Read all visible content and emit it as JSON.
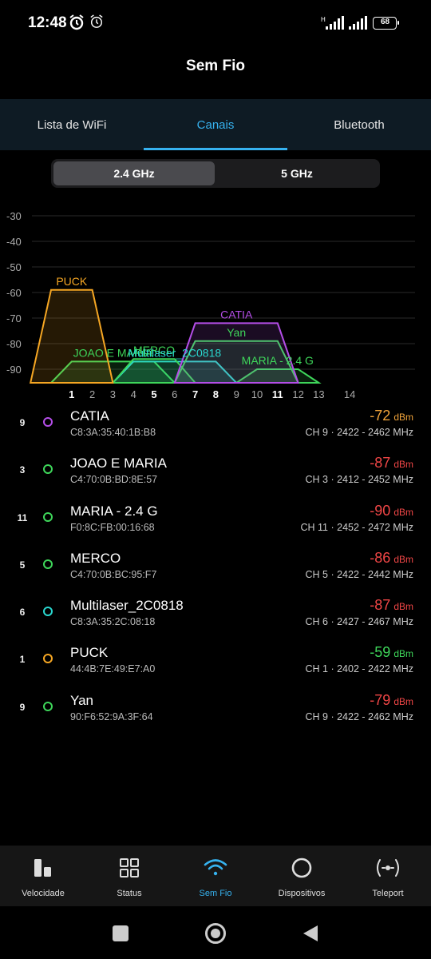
{
  "status": {
    "time": "12:48",
    "battery": "68"
  },
  "header": {
    "title": "Sem Fio"
  },
  "tabs": [
    {
      "label": "Lista de WiFi",
      "active": false
    },
    {
      "label": "Canais",
      "active": true
    },
    {
      "label": "Bluetooth",
      "active": false
    }
  ],
  "band_toggle": [
    {
      "label": "2.4 GHz",
      "active": true
    },
    {
      "label": "5 GHz",
      "active": false
    }
  ],
  "chart_data": {
    "type": "area",
    "y_ticks": [
      "-30",
      "-40",
      "-50",
      "-60",
      "-70",
      "-80",
      "-90"
    ],
    "ylim": [
      -95,
      -28
    ],
    "x_ticks": [
      {
        "label": "1",
        "ch": 1,
        "bold": true
      },
      {
        "label": "2",
        "ch": 2,
        "bold": false
      },
      {
        "label": "3",
        "ch": 3,
        "bold": false
      },
      {
        "label": "4",
        "ch": 4,
        "bold": false
      },
      {
        "label": "5",
        "ch": 5,
        "bold": true
      },
      {
        "label": "6",
        "ch": 6,
        "bold": false
      },
      {
        "label": "7",
        "ch": 7,
        "bold": true
      },
      {
        "label": "8",
        "ch": 8,
        "bold": true
      },
      {
        "label": "9",
        "ch": 9,
        "bold": false
      },
      {
        "label": "10",
        "ch": 10,
        "bold": false
      },
      {
        "label": "11",
        "ch": 11,
        "bold": true
      },
      {
        "label": "12",
        "ch": 12,
        "bold": false
      },
      {
        "label": "13",
        "ch": 13,
        "bold": false
      },
      {
        "label": "14",
        "ch": 14.5,
        "bold": false
      }
    ],
    "series": [
      {
        "name": "PUCK",
        "channel": 1,
        "signal": -59,
        "color": "#f5a623"
      },
      {
        "name": "CATIA",
        "channel": 9,
        "signal": -72,
        "color": "#b44ee8"
      },
      {
        "name": "Yan",
        "channel": 9,
        "signal": -79,
        "color": "#3ed65a"
      },
      {
        "name": "JOAO E MARIA",
        "channel": 3,
        "signal": -87,
        "color": "#3ed65a"
      },
      {
        "name": "MERCO",
        "channel": 5,
        "signal": -86,
        "color": "#3ed65a"
      },
      {
        "name": "Multilaser_2C0818",
        "channel": 6,
        "signal": -87,
        "color": "#2ad8d0"
      },
      {
        "name": "MARIA - 2.4 G",
        "channel": 11,
        "signal": -90,
        "color": "#3ed65a"
      }
    ]
  },
  "networks": [
    {
      "channel": "9",
      "ssid": "CATIA",
      "mac": "C8:3A:35:40:1B:B8",
      "signal": "-72",
      "unit": "dBm",
      "signal_color": "#f0a33a",
      "ring_color": "#b44ee8",
      "freq": "CH 9 · 2422 - 2462 MHz"
    },
    {
      "channel": "3",
      "ssid": "JOAO E MARIA",
      "mac": "C4:70:0B:BD:8E:57",
      "signal": "-87",
      "unit": "dBm",
      "signal_color": "#f04646",
      "ring_color": "#3ed65a",
      "freq": "CH 3 · 2412 - 2452 MHz"
    },
    {
      "channel": "11",
      "ssid": "MARIA - 2.4 G",
      "mac": "F0:8C:FB:00:16:68",
      "signal": "-90",
      "unit": "dBm",
      "signal_color": "#f04646",
      "ring_color": "#3ed65a",
      "freq": "CH 11 · 2452 - 2472 MHz"
    },
    {
      "channel": "5",
      "ssid": "MERCO",
      "mac": "C4:70:0B:BC:95:F7",
      "signal": "-86",
      "unit": "dBm",
      "signal_color": "#f04646",
      "ring_color": "#3ed65a",
      "freq": "CH 5 · 2422 - 2442 MHz"
    },
    {
      "channel": "6",
      "ssid": "Multilaser_2C0818",
      "mac": "C8:3A:35:2C:08:18",
      "signal": "-87",
      "unit": "dBm",
      "signal_color": "#f04646",
      "ring_color": "#2ad8d0",
      "freq": "CH 6 · 2427 - 2467 MHz"
    },
    {
      "channel": "1",
      "ssid": "PUCK",
      "mac": "44:4B:7E:49:E7:A0",
      "signal": "-59",
      "unit": "dBm",
      "signal_color": "#3ed65a",
      "ring_color": "#f5a623",
      "freq": "CH 1 · 2402 - 2422 MHz"
    },
    {
      "channel": "9",
      "ssid": "Yan",
      "mac": "90:F6:52:9A:3F:64",
      "signal": "-79",
      "unit": "dBm",
      "signal_color": "#f04646",
      "ring_color": "#3ed65a",
      "freq": "CH 9 · 2422 - 2462 MHz"
    }
  ],
  "bottom_nav": [
    {
      "label": "Velocidade",
      "icon": "speed-bars-icon",
      "active": false
    },
    {
      "label": "Status",
      "icon": "grid-icon",
      "active": false
    },
    {
      "label": "Sem Fio",
      "icon": "wifi-icon",
      "active": true
    },
    {
      "label": "Dispositivos",
      "icon": "circle-icon",
      "active": false
    },
    {
      "label": "Teleport",
      "icon": "teleport-icon",
      "active": false
    }
  ],
  "colors": {
    "accent": "#36b2ef",
    "tab_bg": "#0e1b24"
  }
}
